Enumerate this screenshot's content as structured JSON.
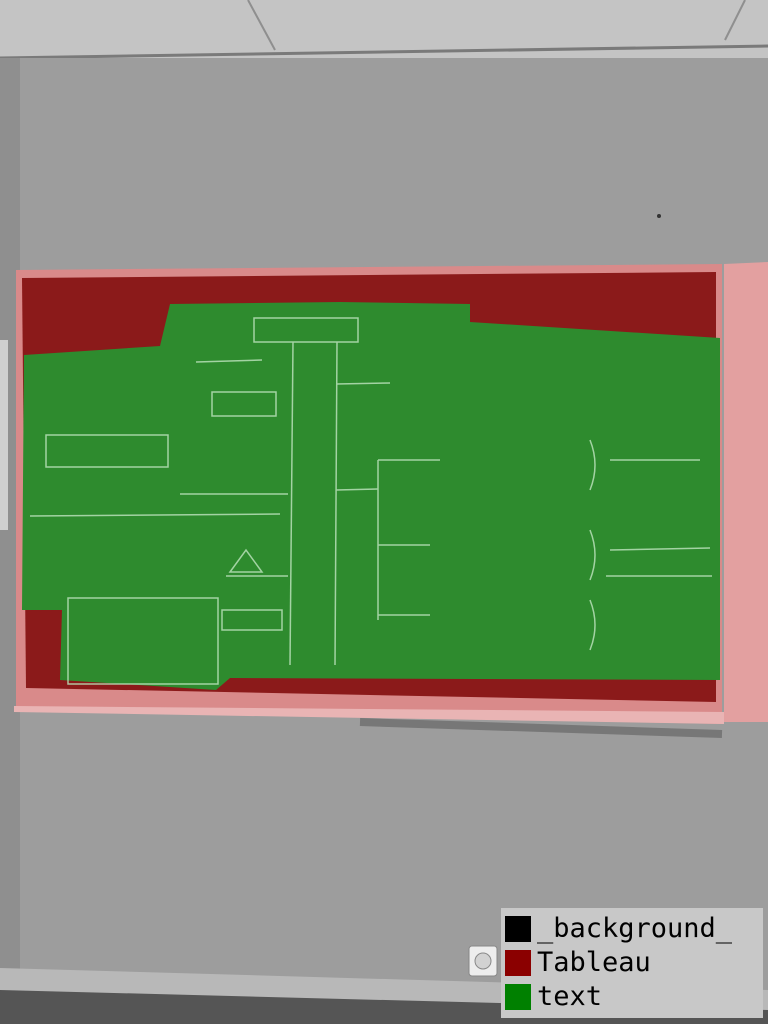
{
  "legend": {
    "items": [
      {
        "label": "_background_",
        "color": "#000000"
      },
      {
        "label": "Tableau",
        "color": "#8b0000"
      },
      {
        "label": "text",
        "color": "#008000"
      }
    ]
  },
  "colors": {
    "wall": "#9a9a9a",
    "ceiling": "#c2c2c2",
    "board_mask": "#8b1a1a",
    "board_frame_mask": "#d98a8a",
    "text_mask": "#2a8a2a"
  }
}
